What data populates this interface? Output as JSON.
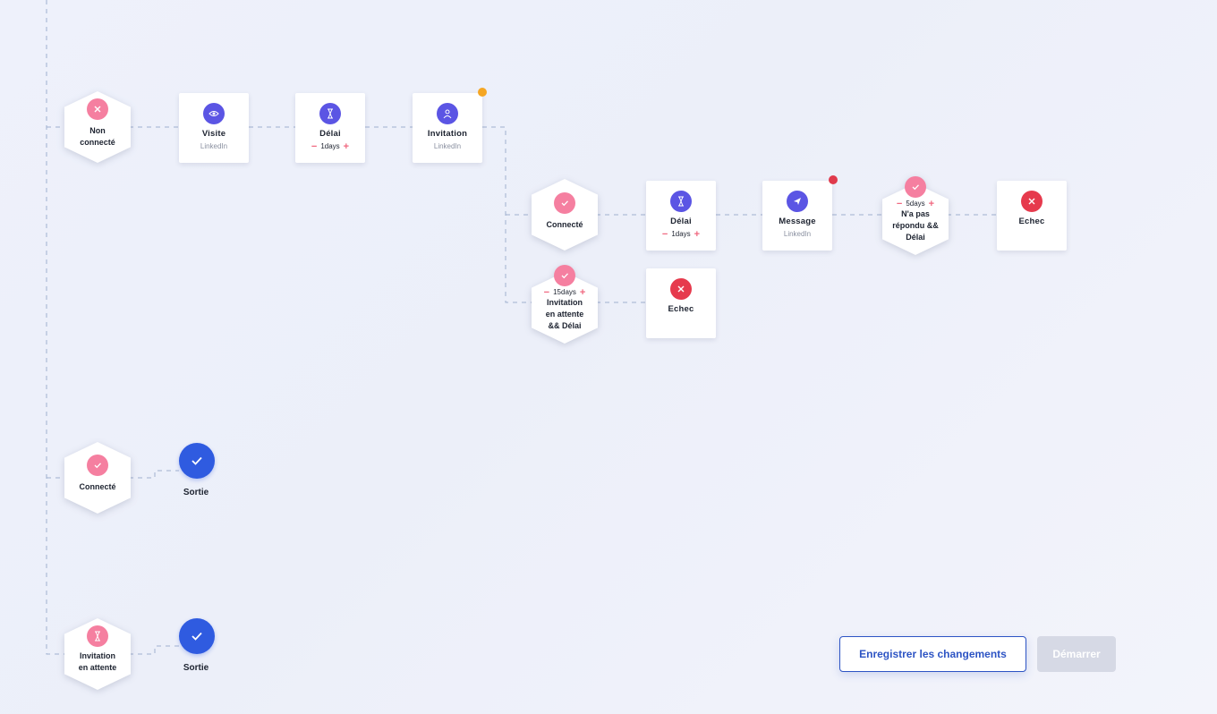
{
  "colors": {
    "accent": "#5b55e4",
    "pink": "#f57fa0",
    "fail_red": "#e63a4d",
    "exit_blue": "#2f5be0",
    "warning_dot": "#f5a623",
    "error_dot": "#e03a4c",
    "primary_button": "#2d54c4",
    "disabled_button": "#d6d9e5"
  },
  "condition_not_connected": {
    "label_line1": "Non",
    "label_line2": "connecté",
    "icon": "close-icon"
  },
  "step_visit": {
    "title": "Visite",
    "sub": "LinkedIn",
    "icon": "eye-icon"
  },
  "step_delay_1": {
    "title": "Délai",
    "minus": "−",
    "value": "1days",
    "plus": "+",
    "icon": "hourglass-icon"
  },
  "step_invitation": {
    "title": "Invitation",
    "sub": "LinkedIn",
    "icon": "user-icon"
  },
  "condition_connected_branch": {
    "label": "Connecté",
    "icon": "check-icon"
  },
  "step_delay_2": {
    "title": "Délai",
    "minus": "−",
    "value": "1days",
    "plus": "+",
    "icon": "hourglass-icon"
  },
  "step_message": {
    "title": "Message",
    "sub": "LinkedIn",
    "icon": "send-icon"
  },
  "condition_no_reply": {
    "minus": "−",
    "value": "5days",
    "plus": "+",
    "line1": "N'a pas",
    "line2": "répondu &&",
    "line3": "Délai",
    "icon": "check-icon"
  },
  "step_fail_1": {
    "title": "Echec",
    "icon": "close-icon"
  },
  "condition_pending_delay": {
    "minus": "−",
    "value": "15days",
    "plus": "+",
    "line1": "Invitation",
    "line2": "en attente",
    "line3": "&& Délai",
    "icon": "check-icon"
  },
  "step_fail_2": {
    "title": "Echec",
    "icon": "close-icon"
  },
  "condition_connected_exit": {
    "label": "Connecté",
    "icon": "check-icon"
  },
  "exit_1": {
    "label": "Sortie",
    "icon": "check-icon"
  },
  "condition_pending_exit": {
    "label_line1": "Invitation",
    "label_line2": "en attente",
    "icon": "hourglass-icon"
  },
  "exit_2": {
    "label": "Sortie",
    "icon": "check-icon"
  },
  "actions": {
    "save_label": "Enregistrer les changements",
    "start_label": "Démarrer"
  }
}
